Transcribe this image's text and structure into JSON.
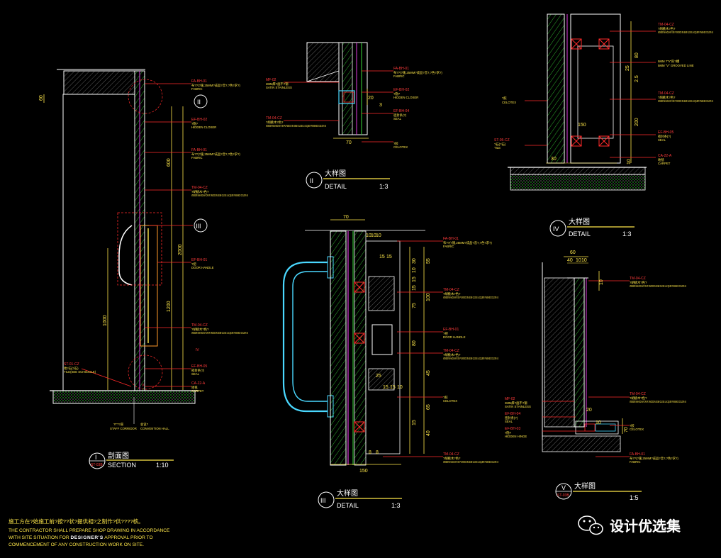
{
  "colors": {
    "background": "#000000",
    "outline_white": "#ffffff",
    "leader_red": "#ff2a2a",
    "dimension_yellow": "#ffe84a",
    "hatch_green": "#38d838",
    "glass_cyan": "#4ad8ff",
    "panel_magenta": "#e03ce0",
    "block_orange": "#ff9a2a"
  },
  "details": {
    "section_I": {
      "number": "I",
      "tag": "ST-03B",
      "title_cn": "剖面图",
      "title_en": "SECTION",
      "scale": "1:10",
      "bottom_labels": [
        "?T??道",
        "会议?"
      ],
      "bottom_labels_en": [
        "STAFF CORRIDOR",
        "CONVENTION HALL"
      ],
      "dims": [
        "60",
        "600",
        "2000",
        "1200",
        "1000"
      ],
      "callouts": [
        {
          "code": "FA-BH-01",
          "cn": "布??(?施,25MM?成品?音?,?色?求?)",
          "en": "FABRIC"
        },
        {
          "code": "EF-BH-02",
          "cn": "?隐?",
          "en": "HIDDEN CLOSER"
        },
        {
          "code": "FA-BH-01",
          "cn": "布??(?施,25MM?成品?音?,?色?求?)",
          "en": "FABRIC"
        },
        {
          "code": "TM-04-CZ",
          "cn": "?胡桃木?色?",
          "en": "VENEER MAHOGANY ON PLYWOOD IN SEMI GLOSS LACQUER FINISHED COLOR AS"
        },
        {
          "code": "EF-BH-01",
          "cn": "?把",
          "en": "DOOR HANDLE"
        },
        {
          "code": "TM-04-CZ",
          "cn": "?胡桃木?色?",
          "en": "VENEER MAHOGANY ON PLYWOOD IN SEMI GLOSS LACQUER FINISHED COLOR AS"
        },
        {
          "code": "EF-BH-05",
          "cn": "密封条(?)",
          "en": "SEAL"
        },
        {
          "code": "CA-22-A",
          "cn": "地毯",
          "en": "CARPET"
        },
        {
          "code": "ST-01-CZ",
          "cn": "地?石(?石)",
          "en": "TILE(SEE SCHEDULE)"
        }
      ],
      "circle_labels": [
        "II",
        "III",
        "IV",
        "V"
      ]
    },
    "detail_II": {
      "number": "II",
      "title_cn": "大样图",
      "title_en": "DETAIL",
      "scale": "1:3",
      "dims": [
        "20",
        "3",
        "70"
      ],
      "callouts": [
        {
          "code": "MF-02",
          "cn": "2MM厚?面不?钢",
          "en": "SATIN STAINLESS"
        },
        {
          "code": "TM-04-CZ",
          "cn": "?胡桃木?色?",
          "en": "VENEER MAHOGANY ON PLYWOOD IN SEMI GLOSS LACQUER FINISHED COLOR AS"
        },
        {
          "code": "FA-BH-01",
          "cn": "布??(?施,25MM?成品?音?,?色?求?)",
          "en": "FABRIC"
        },
        {
          "code": "EF-BH-02",
          "cn": "?隐?",
          "en": "HIDDEN CLOSER"
        },
        {
          "code": "EF-BH-04",
          "cn": "密封条(?)",
          "en": "SEAL"
        },
        {
          "code": "",
          "cn": "?胶",
          "en": "CELOTEX"
        }
      ]
    },
    "detail_III": {
      "number": "III",
      "title_cn": "大样图",
      "title_en": "DETAIL",
      "scale": "1:3",
      "dims": [
        "70",
        "10",
        "10",
        "10",
        "15",
        "15",
        "30",
        "10",
        "55",
        "15",
        "15",
        "100",
        "75",
        "80",
        "45",
        "25",
        "15",
        "15",
        "10",
        "65",
        "15",
        "40",
        "8",
        "8",
        "150"
      ],
      "callouts": [
        {
          "code": "FA-BH-01",
          "cn": "布??(?施,25MM?成品?音?,?色?求?)",
          "en": "FABRIC"
        },
        {
          "code": "TM-04-CZ",
          "cn": "?胡桃木?色?",
          "en": "VENEER MAHOGANY ON PLYWOOD IN SEMI GLOSS LACQUER FINISHED COLOR AS"
        },
        {
          "code": "EF-BH-01",
          "cn": "?把",
          "en": "DOOR HANDLE"
        },
        {
          "code": "TM-04-CZ",
          "cn": "?胡桃木?色?",
          "en": "VENEER MAHOGANY ON PLYWOOD IN SEMI GLOSS LACQUER FINISHED COLOR AS"
        },
        {
          "code": "",
          "cn": "?胶",
          "en": "CELOTEX"
        },
        {
          "code": "TM-04-CZ",
          "cn": "?胡桃木?色?",
          "en": "VENEER MAHOGANY ON PLYWOOD IN SEMI GLOSS LACQUER FINISHED COLOR AS"
        }
      ]
    },
    "detail_IV": {
      "number": "IV",
      "title_cn": "大样图",
      "title_en": "DETAIL",
      "scale": "1:3",
      "dims": [
        "80",
        "25",
        "2.5",
        "200",
        "150",
        "30",
        "10"
      ],
      "callouts": [
        {
          "code": "TM-04-CZ",
          "cn": "?胡桃木?色?",
          "en": "VENEER MAHOGANY ON PLYWOOD IN SEMI GLOSS LACQUER FINISHED COLOR AS"
        },
        {
          "code": "",
          "cn": "5MM ?\"V\"形?槽",
          "en": "5MM \"V\" GROOVED LINE"
        },
        {
          "code": "TM-04-CZ",
          "cn": "?胡桃木?色?",
          "en": "VENEER MAHOGANY ON PLYWOOD IN SEMI GLOSS LACQUER FINISHED COLOR AS"
        },
        {
          "code": "",
          "cn": "?胶",
          "en": "CELOTEX"
        },
        {
          "code": "EF-BH-05",
          "cn": "密封条(?)",
          "en": "SEAL"
        },
        {
          "code": "ST-05-CZ",
          "cn": "?石(?石)",
          "en": "TILE"
        },
        {
          "code": "CA-22-A",
          "cn": "地毯",
          "en": "CARPET"
        }
      ]
    },
    "detail_V": {
      "number": "V",
      "tag": "ST-03B",
      "title_cn": "大样图",
      "title_en": "",
      "scale": "1:5",
      "dims": [
        "60",
        "40",
        "10",
        "10",
        "10",
        "20",
        "10",
        "70"
      ],
      "callouts": [
        {
          "code": "TM-04-CZ",
          "cn": "?胡桃木?色?",
          "en": "VENEER MAHOGANY ON PLYWOOD IN SEMI GLOSS LACQUER FINISHED COLOR AS"
        },
        {
          "code": "MF-02",
          "cn": "2MM厚?面不?钢",
          "en": "SATIN STAINLESS"
        },
        {
          "code": "EF-BH-04",
          "cn": "密封条(?)",
          "en": "SEAL"
        },
        {
          "code": "EF-BH-03",
          "cn": "?隐?",
          "en": "HIDDEN HINGE"
        },
        {
          "code": "TM-04-CZ",
          "cn": "?胡桃木?色?",
          "en": "VENEER MAHOGANY ON PLYWOOD IN SEMI GLOSS LACQUER FINISHED COLOR AS"
        },
        {
          "code": "",
          "cn": "?胶",
          "en": "CELOTEX"
        },
        {
          "code": "FA-BH-01",
          "cn": "布??(?施,25MM?成品?音?,?色?求?)",
          "en": "FABRIC"
        }
      ]
    }
  },
  "footnote": {
    "cn": "施工方在?始施工前?按??状?提供相?之制作?供????核。",
    "en_line1": "THE CONTRACTOR SHALL PREPARE SHOP DRAWING IN ACCORDANCE",
    "en_line2_a": "WITH SITE SITUATION FOR ",
    "en_line2_b": "DESIGNER'S",
    "en_line2_c": " APPROVAL PRIOR TO",
    "en_line3": "COMMENCEMENT OF ANY CONSTRUCTION WORK ON SITE."
  },
  "watermark": {
    "icon": "wechat-icon",
    "text": "设计优选集"
  }
}
